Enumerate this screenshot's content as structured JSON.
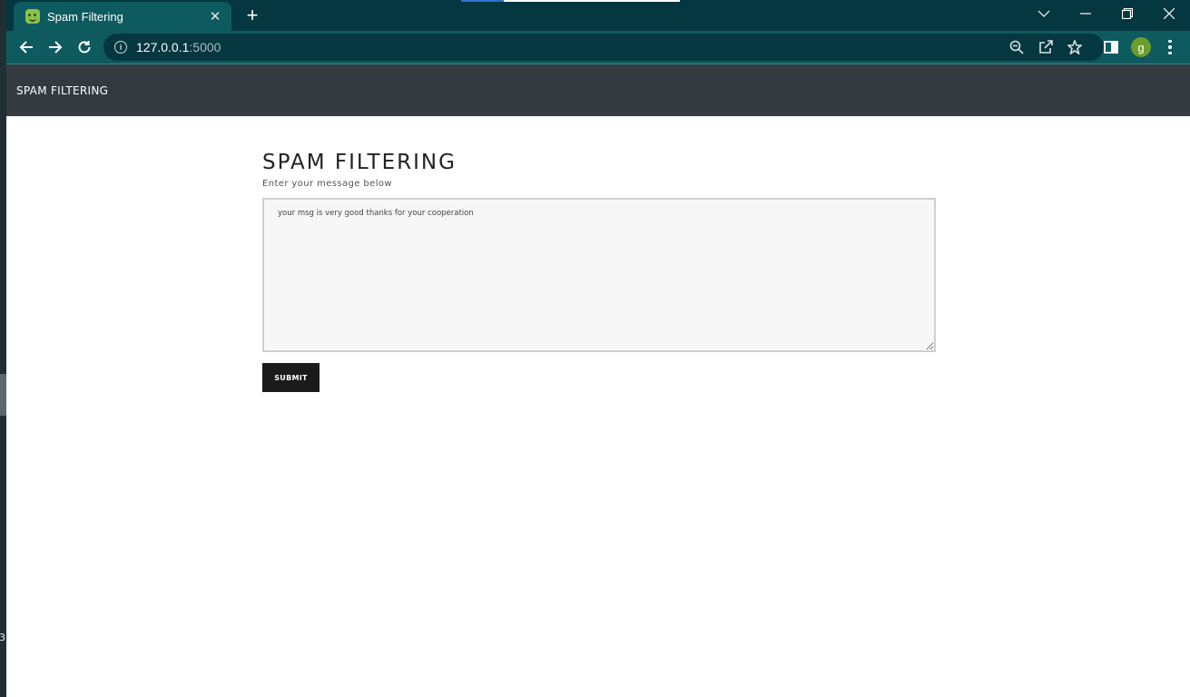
{
  "browser": {
    "tab_title": "Spam Filtering",
    "tab_close": "✕",
    "new_tab": "+",
    "url_host": "127.0.0.1",
    "url_port": ":5000",
    "info_icon": "i",
    "profile_initial": "g",
    "accent_color": "#0d5a5f",
    "icons": [
      "back-icon",
      "forward-icon",
      "reload-icon",
      "info-icon",
      "zoom-icon",
      "share-icon",
      "bookmark-star-icon",
      "side-panel-icon",
      "menu-icon"
    ]
  },
  "site": {
    "brand": "SPAM FILTERING",
    "nav_color": "#343a40"
  },
  "main": {
    "heading": "SPAM FILTERING",
    "subtitle": "Enter your message below",
    "message_value": "your msg is very good thanks for your cooperation",
    "submit_label": "SUBMIT"
  }
}
